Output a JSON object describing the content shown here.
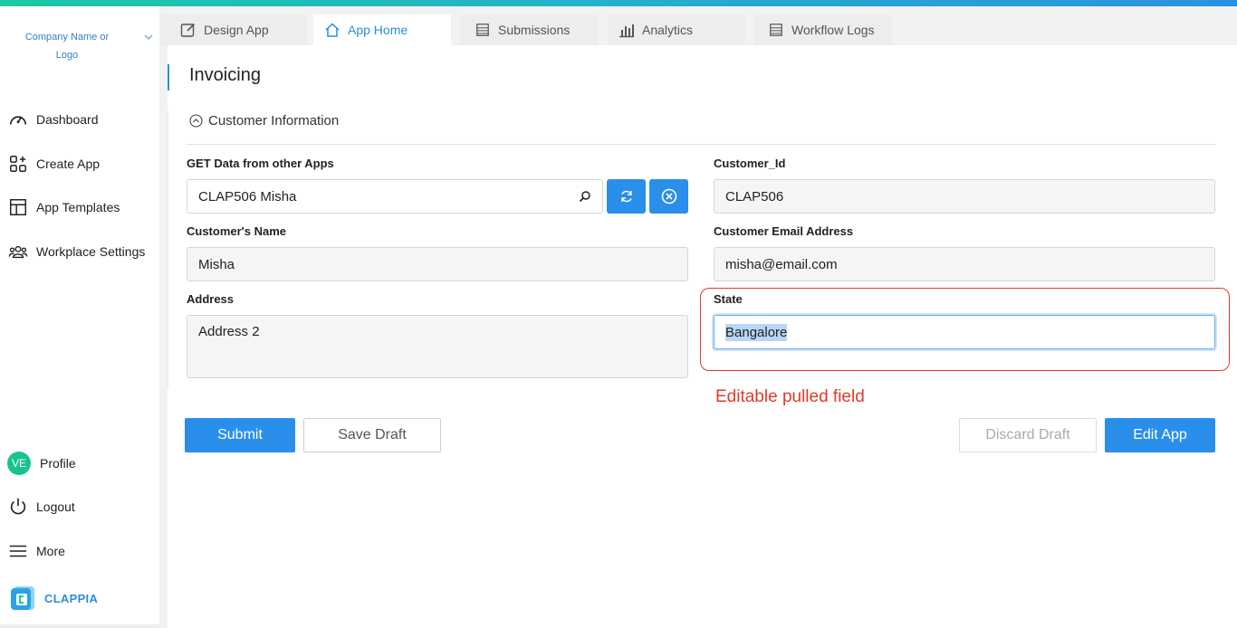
{
  "colors": {
    "accent": "#2a8fea",
    "annotation": "#e23a2a",
    "avatar": "#19c38f"
  },
  "sidebar": {
    "company": "Company Name or Logo",
    "items": [
      {
        "label": "Dashboard",
        "icon": "dashboard-icon"
      },
      {
        "label": "Create App",
        "icon": "create-app-icon"
      },
      {
        "label": "App Templates",
        "icon": "templates-icon"
      },
      {
        "label": "Workplace Settings",
        "icon": "users-icon"
      }
    ],
    "profile": {
      "initials": "VE",
      "label": "Profile"
    },
    "logout": "Logout",
    "more": "More",
    "brand": "CLAPPIA"
  },
  "tabs": [
    {
      "label": "Design App",
      "icon": "edit-icon"
    },
    {
      "label": "App Home",
      "icon": "home-icon",
      "active": true
    },
    {
      "label": "Submissions",
      "icon": "list-icon"
    },
    {
      "label": "Analytics",
      "icon": "chart-icon"
    },
    {
      "label": "Workflow Logs",
      "icon": "list-icon"
    }
  ],
  "page": {
    "title": "Invoicing",
    "section": "Customer Information"
  },
  "form": {
    "get_data": {
      "label": "GET Data from other Apps",
      "value": "CLAP506 Misha"
    },
    "customer_id": {
      "label": "Customer_Id",
      "value": "CLAP506"
    },
    "customer_name": {
      "label": "Customer's Name",
      "value": "Misha"
    },
    "customer_email": {
      "label": "Customer Email Address",
      "value": "misha@email.com"
    },
    "address": {
      "label": "Address",
      "value": "Address 2"
    },
    "state": {
      "label": "State",
      "value": "Bangalore"
    }
  },
  "annotation": "Editable pulled field",
  "buttons": {
    "submit": "Submit",
    "save_draft": "Save Draft",
    "discard_draft": "Discard Draft",
    "edit_app": "Edit App"
  }
}
